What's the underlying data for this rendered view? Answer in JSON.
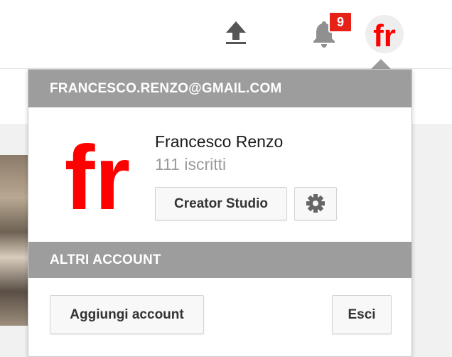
{
  "header": {
    "notifications": {
      "count": "9"
    },
    "upload_icon": "upload-arrow-icon",
    "bell_icon": "bell-icon"
  },
  "account_menu": {
    "email": "FRANCESCO.RENZO@GMAIL.COM",
    "avatar_text": "fr",
    "name": "Francesco Renzo",
    "subscribers": "111 iscritti",
    "creator_studio_label": "Creator Studio",
    "settings_icon": "gear-icon",
    "other_accounts_heading": "ALTRI ACCOUNT",
    "add_account_label": "Aggiungi account",
    "logout_label": "Esci"
  },
  "colors": {
    "brand_red": "#e62117",
    "avatar_red": "#ff0000",
    "header_gray": "#9d9d9d",
    "button_bg": "#f8f8f8"
  }
}
